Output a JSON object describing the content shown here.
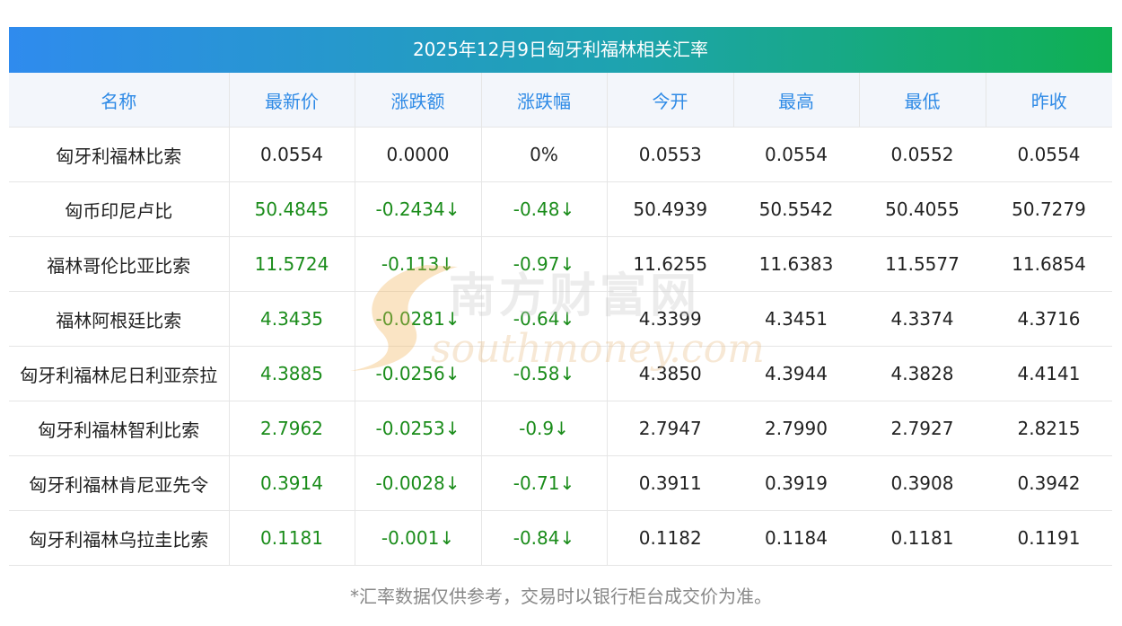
{
  "title": "2025年12月9日匈牙利福林相关汇率",
  "columns": [
    "名称",
    "最新价",
    "涨跌额",
    "涨跌幅",
    "今开",
    "最高",
    "最低",
    "昨收"
  ],
  "rows": [
    {
      "name": "匈牙利福林比索",
      "latest": "0.0554",
      "change": "0.0000",
      "pct": "0%",
      "open": "0.0553",
      "high": "0.0554",
      "low": "0.0552",
      "prev": "0.0554",
      "dir": "flat"
    },
    {
      "name": "匈币印尼卢比",
      "latest": "50.4845",
      "change": "-0.2434↓",
      "pct": "-0.48↓",
      "open": "50.4939",
      "high": "50.5542",
      "low": "50.4055",
      "prev": "50.7279",
      "dir": "down"
    },
    {
      "name": "福林哥伦比亚比索",
      "latest": "11.5724",
      "change": "-0.113↓",
      "pct": "-0.97↓",
      "open": "11.6255",
      "high": "11.6383",
      "low": "11.5577",
      "prev": "11.6854",
      "dir": "down"
    },
    {
      "name": "福林阿根廷比索",
      "latest": "4.3435",
      "change": "-0.0281↓",
      "pct": "-0.64↓",
      "open": "4.3399",
      "high": "4.3451",
      "low": "4.3374",
      "prev": "4.3716",
      "dir": "down"
    },
    {
      "name": "匈牙利福林尼日利亚奈拉",
      "latest": "4.3885",
      "change": "-0.0256↓",
      "pct": "-0.58↓",
      "open": "4.3850",
      "high": "4.3944",
      "low": "4.3828",
      "prev": "4.4141",
      "dir": "down"
    },
    {
      "name": "匈牙利福林智利比索",
      "latest": "2.7962",
      "change": "-0.0253↓",
      "pct": "-0.9↓",
      "open": "2.7947",
      "high": "2.7990",
      "low": "2.7927",
      "prev": "2.8215",
      "dir": "down"
    },
    {
      "name": "匈牙利福林肯尼亚先令",
      "latest": "0.3914",
      "change": "-0.0028↓",
      "pct": "-0.71↓",
      "open": "0.3911",
      "high": "0.3919",
      "low": "0.3908",
      "prev": "0.3942",
      "dir": "down"
    },
    {
      "name": "匈牙利福林乌拉圭比索",
      "latest": "0.1181",
      "change": "-0.001↓",
      "pct": "-0.84↓",
      "open": "0.1182",
      "high": "0.1184",
      "low": "0.1181",
      "prev": "0.1191",
      "dir": "down"
    }
  ],
  "footnote": "*汇率数据仅供参考，交易时以银行柜台成交价为准。",
  "watermark": {
    "cn": "南方财富网",
    "en": "southmoney.com"
  },
  "colors": {
    "header_text": "#2e8ae6",
    "change_text": "#1a8c1a",
    "title_grad_start": "#2f8bee",
    "title_grad_end": "#0fb052"
  }
}
